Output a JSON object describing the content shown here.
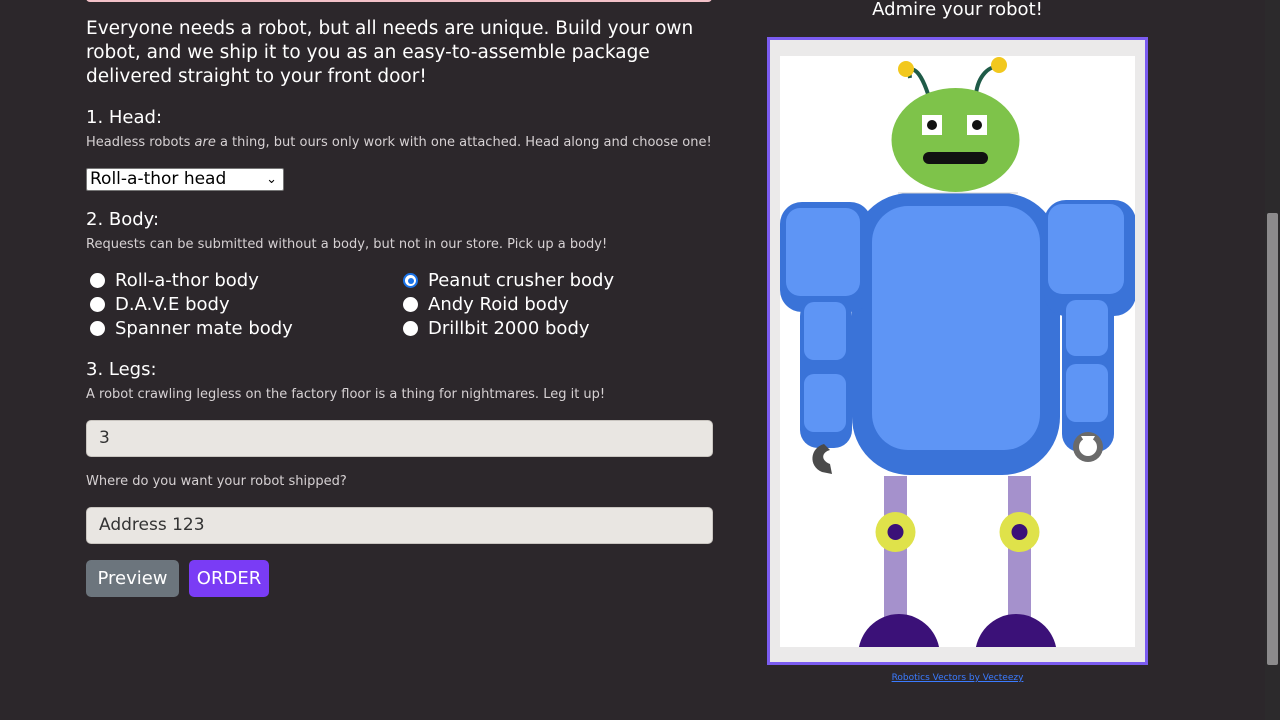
{
  "intro": "Everyone needs a robot, but all needs are unique. Build your own robot, and we ship it to you as an easy-to-assemble package delivered straight to your front door!",
  "head": {
    "title": "1. Head:",
    "hint_pre": "Headless robots ",
    "hint_em": "are",
    "hint_post": " a thing, but ours only work with one attached. Head along and choose one!",
    "selected": "Roll-a-thor head"
  },
  "body": {
    "title": "2. Body:",
    "hint": "Requests can be submitted without a body, but not in our store. Pick up a body!",
    "options": [
      {
        "label": "Roll-a-thor body",
        "checked": false
      },
      {
        "label": "Peanut crusher body",
        "checked": true
      },
      {
        "label": "D.A.V.E body",
        "checked": false
      },
      {
        "label": "Andy Roid body",
        "checked": false
      },
      {
        "label": "Spanner mate body",
        "checked": false
      },
      {
        "label": "Drillbit 2000 body",
        "checked": false
      }
    ]
  },
  "legs": {
    "title": "3. Legs:",
    "hint": "A robot crawling legless on the factory floor is a thing for nightmares. Leg it up!",
    "value": "3"
  },
  "shipping": {
    "label": "Where do you want your robot shipped?",
    "value": "Address 123"
  },
  "buttons": {
    "preview": "Preview",
    "order": "ORDER"
  },
  "preview_panel": {
    "title": "Admire your robot!",
    "credit": "Robotics Vectors by Vecteezy"
  },
  "colors": {
    "background": "#2c272b",
    "accent": "#7a3cf5",
    "frame_border": "#7b5cf0",
    "radio_checked": "#1a73e8",
    "robot_head": "#7ec34a",
    "robot_body": "#3a73d8",
    "robot_legs": "#a591cc",
    "robot_feet": "#3b1178"
  }
}
